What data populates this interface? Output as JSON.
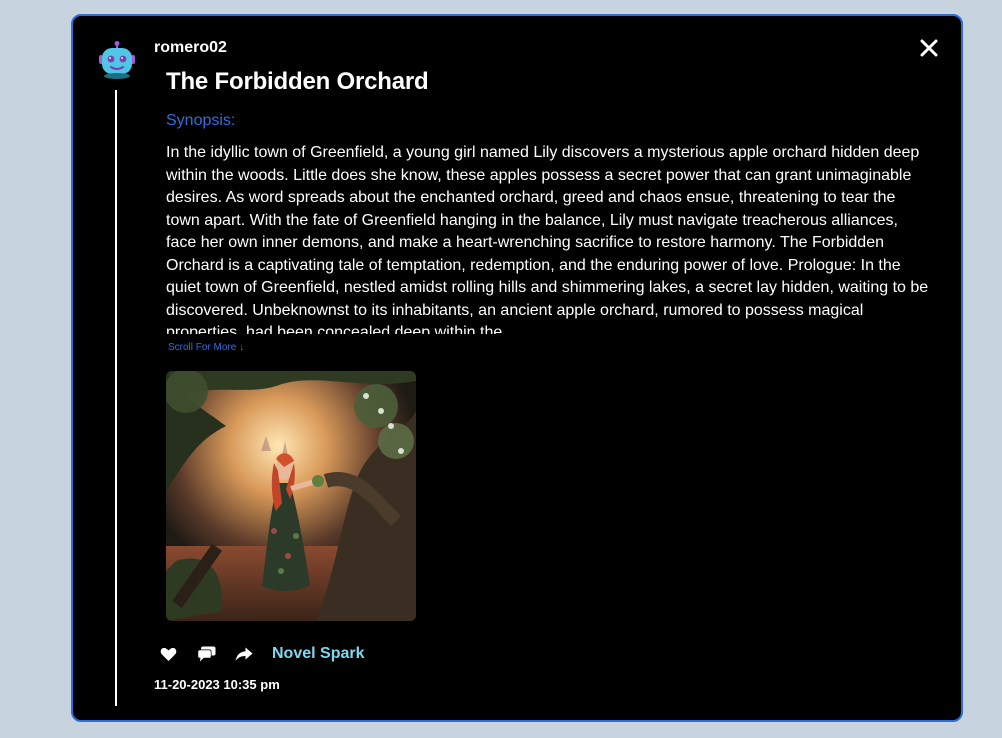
{
  "post": {
    "username": "romero02",
    "title": "The Forbidden Orchard",
    "synopsis_label": "Synopsis:",
    "synopsis_text": "In the idyllic town of Greenfield, a young girl named Lily discovers a mysterious apple orchard hidden deep within the woods. Little does she know, these apples possess a secret power that can grant unimaginable desires. As word spreads about the enchanted orchard, greed and chaos ensue, threatening to tear the town apart. With the fate of Greenfield hanging in the balance, Lily must navigate treacherous alliances, face her own inner demons, and make a heart-wrenching sacrifice to restore harmony. The Forbidden Orchard is a captivating tale of temptation, redemption, and the enduring power of love. Prologue: In the quiet town of Greenfield, nestled amidst rolling hills and shimmering lakes, a secret lay hidden, waiting to be discovered. Unbeknownst to its inhabitants, an ancient apple orchard, rumored to possess magical properties, had been concealed deep within the",
    "scroll_more": "Scroll For More ↓",
    "brand": "Novel Spark",
    "timestamp": "11-20-2023 10:35 pm"
  },
  "icons": {
    "avatar": "robot-avatar-icon",
    "close": "close-icon",
    "like": "heart-icon",
    "comment": "comment-icon",
    "share": "share-icon"
  },
  "colors": {
    "page_background": "#c7d3df",
    "modal_background": "#000000",
    "modal_border": "#2c6fd8",
    "accent_blue": "#2f6fe0",
    "brand_cyan": "#7fd8f0"
  }
}
